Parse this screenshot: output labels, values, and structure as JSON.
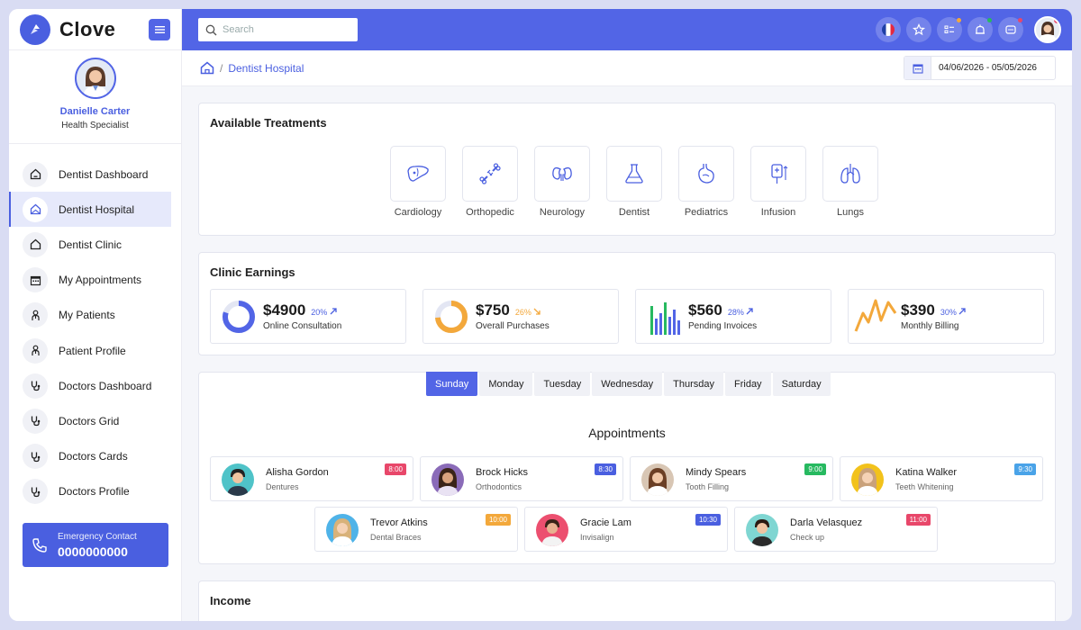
{
  "brand": {
    "name": "Clove"
  },
  "colors": {
    "accent": "#5265e6",
    "red": "#e8476a",
    "blue": "#4a5fe0",
    "green": "#27b960",
    "sky": "#4aa3e8",
    "orange": "#f3a83b"
  },
  "profile": {
    "name": "Danielle Carter",
    "role": "Health Specialist"
  },
  "nav": [
    {
      "label": "Dentist Dashboard",
      "icon": "home-icon"
    },
    {
      "label": "Dentist Hospital",
      "icon": "hospital-icon"
    },
    {
      "label": "Dentist Clinic",
      "icon": "home-icon"
    },
    {
      "label": "My Appointments",
      "icon": "calendar-icon"
    },
    {
      "label": "My Patients",
      "icon": "patient-icon"
    },
    {
      "label": "Patient Profile",
      "icon": "patient-icon"
    },
    {
      "label": "Doctors Dashboard",
      "icon": "stethoscope-icon"
    },
    {
      "label": "Doctors Grid",
      "icon": "stethoscope-icon"
    },
    {
      "label": "Doctors Cards",
      "icon": "stethoscope-icon"
    },
    {
      "label": "Doctors Profile",
      "icon": "stethoscope-icon"
    }
  ],
  "emergency": {
    "label": "Emergency Contact",
    "number": "0000000000"
  },
  "search": {
    "placeholder": "Search"
  },
  "breadcrumb": {
    "current": "Dentist Hospital"
  },
  "daterange": {
    "value": "04/06/2026 - 05/05/2026"
  },
  "treatments": {
    "title": "Available Treatments",
    "items": [
      {
        "label": "Cardiology",
        "icon": "liver-icon"
      },
      {
        "label": "Orthopedic",
        "icon": "bone-icon"
      },
      {
        "label": "Neurology",
        "icon": "kidney-icon"
      },
      {
        "label": "Dentist",
        "icon": "flask-icon"
      },
      {
        "label": "Pediatrics",
        "icon": "stomach-icon"
      },
      {
        "label": "Infusion",
        "icon": "infusion-icon"
      },
      {
        "label": "Lungs",
        "icon": "lungs-icon"
      }
    ]
  },
  "earnings": {
    "title": "Clinic Earnings",
    "items": [
      {
        "value": "$4900",
        "pct": "20%",
        "label": "Online Consultation",
        "trend": "up",
        "color": "#5265e6",
        "fill": 0.8
      },
      {
        "value": "$750",
        "pct": "26%",
        "label": "Overall Purchases",
        "trend": "down",
        "color": "#f3a83b",
        "fill": 0.74
      },
      {
        "value": "$560",
        "pct": "28%",
        "label": "Pending Invoices",
        "trend": "up",
        "color": "#5265e6"
      },
      {
        "value": "$390",
        "pct": "30%",
        "label": "Monthly Billing",
        "trend": "up",
        "color": "#5265e6"
      }
    ]
  },
  "days": [
    "Sunday",
    "Monday",
    "Tuesday",
    "Wednesday",
    "Thursday",
    "Friday",
    "Saturday"
  ],
  "appointments": {
    "title": "Appointments",
    "items": [
      {
        "name": "Alisha Gordon",
        "treatment": "Dentures",
        "time": "8:00",
        "color": "#e8476a"
      },
      {
        "name": "Brock Hicks",
        "treatment": "Orthodontics",
        "time": "8:30",
        "color": "#4a5fe0"
      },
      {
        "name": "Mindy Spears",
        "treatment": "Tooth Filling",
        "time": "9:00",
        "color": "#27b960"
      },
      {
        "name": "Katina Walker",
        "treatment": "Teeth Whitening",
        "time": "9:30",
        "color": "#4aa3e8"
      },
      {
        "name": "Trevor Atkins",
        "treatment": "Dental Braces",
        "time": "10:00",
        "color": "#f3a83b"
      },
      {
        "name": "Gracie Lam",
        "treatment": "Invisalign",
        "time": "10:30",
        "color": "#4a5fe0"
      },
      {
        "name": "Darla Velasquez",
        "treatment": "Check up",
        "time": "11:00",
        "color": "#e8476a"
      }
    ]
  },
  "income": {
    "title": "Income"
  }
}
